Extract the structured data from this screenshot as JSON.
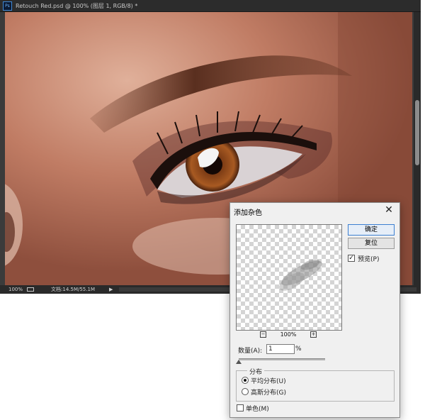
{
  "document_window": {
    "app_badge": "Ps",
    "title": "Retouch Red.psd @ 100% (图层 1, RGB/8) *",
    "status": {
      "zoom": "100%",
      "doc_info": "文档:14.5M/55.1M",
      "arrow": "▶"
    }
  },
  "dialog": {
    "title": "添加杂色",
    "close_label": "✕",
    "ok_label": "确定",
    "reset_label": "复位",
    "preview_label": "预览(P)",
    "preview_checked": true,
    "preview_zoom": "100%",
    "zoom_out": "−",
    "zoom_in": "+",
    "amount_label": "数量(A):",
    "amount_value": "1",
    "amount_unit": "%",
    "amount_fraction": 0.0025,
    "distribution": {
      "legend": "分布",
      "uniform_label": "平均分布(U)",
      "gaussian_label": "高斯分布(G)",
      "selected": "uniform"
    },
    "monochromatic_label": "单色(M)",
    "monochromatic_checked": false
  },
  "colors": {
    "ps_dark": "#2c2c2c",
    "skin": "#c58670",
    "accent_blue": "#3c7fd1"
  }
}
